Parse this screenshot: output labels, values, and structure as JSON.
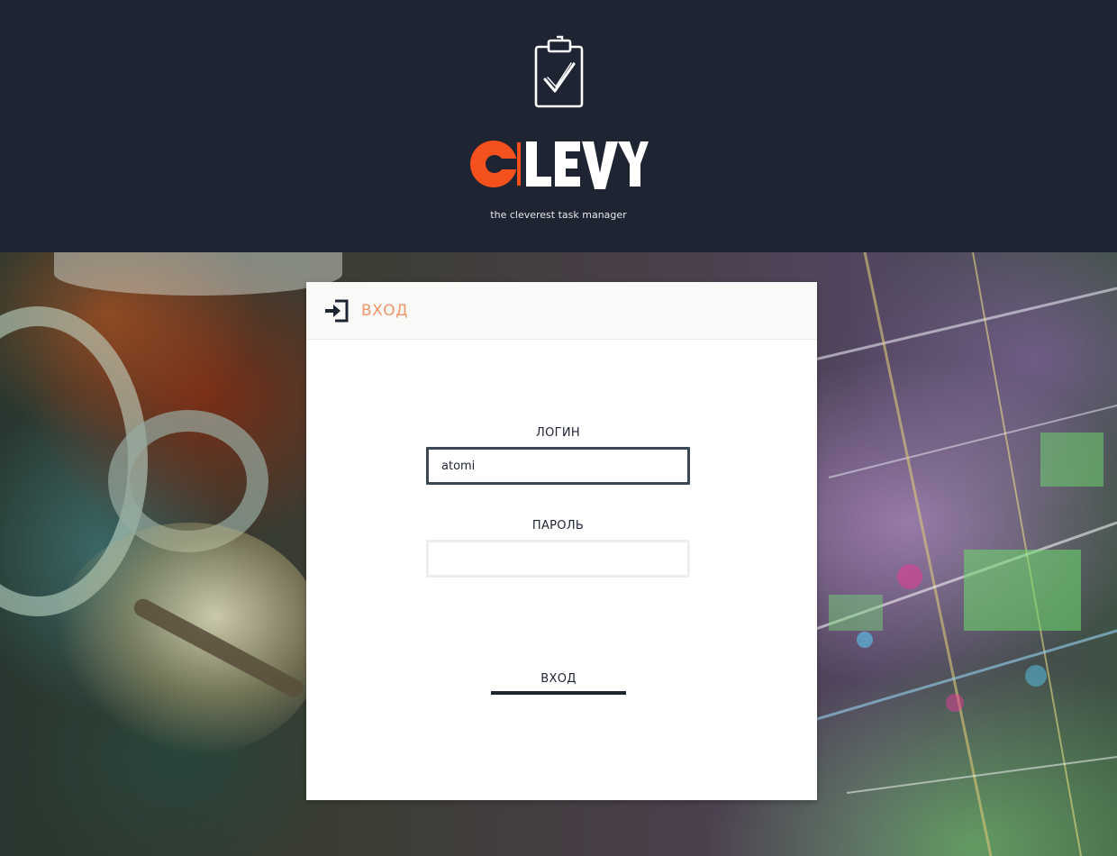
{
  "header": {
    "logo_text": "CLEVY",
    "tagline": "the cleverest task manager",
    "logo_accent_color": "#f4511e",
    "background_color": "#1f2433",
    "icons": [
      "clipboard-check-icon"
    ]
  },
  "login_card": {
    "title": "ВХОД",
    "title_color": "#f0946a",
    "icon": "sign-in-icon",
    "login_label": "ЛОГИН",
    "login_value": "atomi",
    "password_label": "ПАРОЛЬ",
    "password_value": "",
    "submit_label": "ВХОД"
  }
}
